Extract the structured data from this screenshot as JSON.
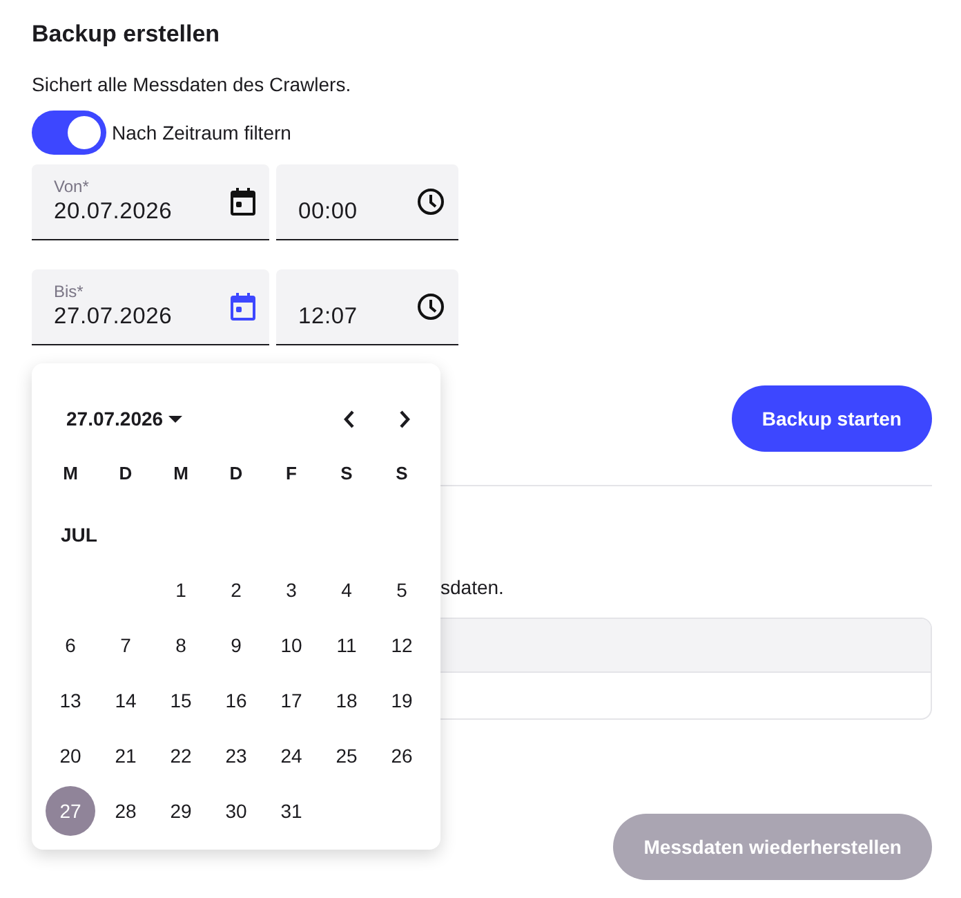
{
  "title": "Backup erstellen",
  "description": "Sichert alle Messdaten des Crawlers.",
  "filter_toggle": {
    "label": "Nach Zeitraum filtern",
    "on": true
  },
  "date_rows": [
    {
      "date": {
        "label": "Von*",
        "value": "20.07.2026",
        "focused": false
      },
      "time": {
        "value": "00:00"
      }
    },
    {
      "date": {
        "label": "Bis*",
        "value": "27.07.2026",
        "focused": true
      },
      "time": {
        "value": "12:07"
      }
    }
  ],
  "start_button": {
    "label": "Backup starten",
    "disabled": false
  },
  "restore": {
    "description_tail": "sdaten.",
    "button": {
      "label": "Messdaten wiederherstellen",
      "disabled": true
    }
  },
  "calendar": {
    "header": "27.07.2026",
    "weekdays": [
      "M",
      "D",
      "M",
      "D",
      "F",
      "S",
      "S"
    ],
    "month": "JUL",
    "weeks": [
      {
        "days": [
          {
            "day": "1",
            "selected": false
          },
          {
            "day": "2",
            "selected": false
          },
          {
            "day": "3",
            "selected": false
          },
          {
            "day": "4",
            "selected": false
          },
          {
            "day": "5",
            "selected": false
          }
        ]
      },
      {
        "days": [
          {
            "day": "6",
            "selected": false
          },
          {
            "day": "7",
            "selected": false
          },
          {
            "day": "8",
            "selected": false
          },
          {
            "day": "9",
            "selected": false
          },
          {
            "day": "10",
            "selected": false
          },
          {
            "day": "11",
            "selected": false
          },
          {
            "day": "12",
            "selected": false
          }
        ]
      },
      {
        "days": [
          {
            "day": "13",
            "selected": false
          },
          {
            "day": "14",
            "selected": false
          },
          {
            "day": "15",
            "selected": false
          },
          {
            "day": "16",
            "selected": false
          },
          {
            "day": "17",
            "selected": false
          },
          {
            "day": "18",
            "selected": false
          },
          {
            "day": "19",
            "selected": false
          }
        ]
      },
      {
        "days": [
          {
            "day": "20",
            "selected": false
          },
          {
            "day": "21",
            "selected": false
          },
          {
            "day": "22",
            "selected": false
          },
          {
            "day": "23",
            "selected": false
          },
          {
            "day": "24",
            "selected": false
          },
          {
            "day": "25",
            "selected": false
          },
          {
            "day": "26",
            "selected": false
          }
        ]
      },
      {
        "days": [
          {
            "day": "27",
            "selected": true
          },
          {
            "day": "28",
            "selected": false
          },
          {
            "day": "29",
            "selected": false
          },
          {
            "day": "30",
            "selected": false
          },
          {
            "day": "31",
            "selected": false
          }
        ]
      }
    ]
  }
}
